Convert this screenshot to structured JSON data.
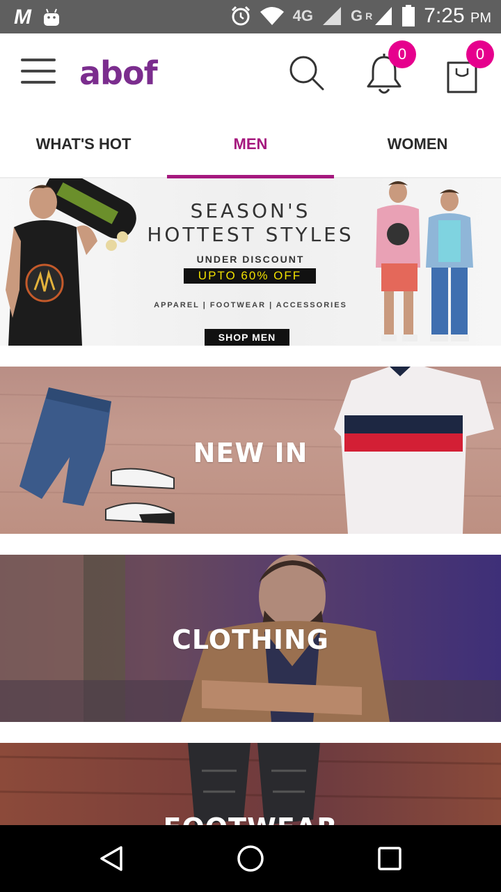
{
  "status_bar": {
    "carrier_icon": "M",
    "network_4g": "4G",
    "network_g": "G",
    "network_r": "R",
    "time": "7:25",
    "ampm": "PM"
  },
  "app_bar": {
    "logo": "abof",
    "notifications_count": "0",
    "cart_count": "0"
  },
  "tabs": [
    {
      "label": "WHAT'S HOT",
      "active": false
    },
    {
      "label": "MEN",
      "active": true
    },
    {
      "label": "WOMEN",
      "active": false
    }
  ],
  "hero": {
    "title_line1": "SEASON'S",
    "title_line2": "HOTTEST STYLES",
    "subtitle": "UNDER DISCOUNT",
    "discount": "UPTO 60% OFF",
    "categories": "APPAREL | FOOTWEAR | ACCESSORIES",
    "cta": "SHOP MEN"
  },
  "banners": {
    "new_in": "NEW IN",
    "clothing": "CLOTHING",
    "footwear": "FOOTWEAR"
  },
  "colors": {
    "brand": "#7b2d8e",
    "accent": "#a5187e",
    "badge": "#e6008d"
  }
}
